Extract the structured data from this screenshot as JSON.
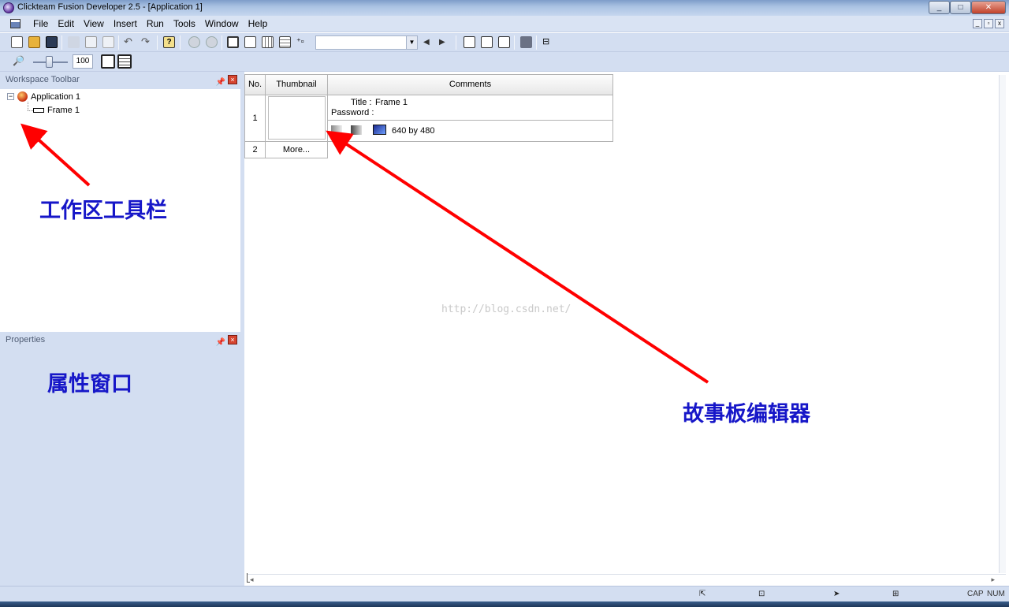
{
  "window": {
    "title": "Clickteam Fusion Developer 2.5 - [Application 1]",
    "buttons": [
      "_",
      "□",
      "✕"
    ]
  },
  "menubar": {
    "items": [
      "File",
      "Edit",
      "View",
      "Insert",
      "Run",
      "Tools",
      "Window",
      "Help"
    ],
    "mdi_buttons": [
      "_",
      "▫",
      "x"
    ]
  },
  "toolbar2": {
    "zoom_value": "100"
  },
  "workspace": {
    "header": "Workspace Toolbar",
    "tree": {
      "root": "Application 1",
      "children": [
        "Frame 1"
      ]
    }
  },
  "properties": {
    "header": "Properties"
  },
  "storyboard": {
    "columns": [
      "No.",
      "Thumbnail",
      "Comments"
    ],
    "rows": [
      {
        "no": "1",
        "title_label": "Title :",
        "title_value": "Frame 1",
        "password_label": "Password :",
        "size_text": "640  by  480"
      },
      {
        "no": "2",
        "more": "More..."
      }
    ]
  },
  "watermark": "http://blog.csdn.net/",
  "annotations": {
    "workspace_toolbar": "工作区工具栏",
    "properties_window": "属性窗口",
    "storyboard_editor": "故事板编辑器"
  },
  "statusbar": {
    "cap": "CAP",
    "num": "NUM"
  },
  "colors": {
    "annotation": "#1616c8",
    "arrow": "#ff0000",
    "chrome": "#d3def1"
  }
}
